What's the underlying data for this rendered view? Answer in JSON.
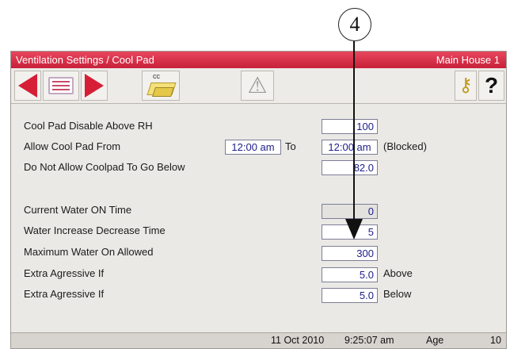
{
  "callout": {
    "number": "4"
  },
  "window": {
    "title": "Ventilation Settings / Cool Pad",
    "house": "Main House 1"
  },
  "toolbar": {
    "prev": "left-arrow-icon",
    "menu": "list-menu-icon",
    "next": "right-arrow-icon",
    "coolpad": "cool-pad-icon",
    "coolpad_text": "cc",
    "alarm": "warning-icon",
    "access": "keys-icon",
    "help": "?"
  },
  "settings": {
    "disable_rh": {
      "label": "Cool Pad Disable Above RH",
      "value": "100"
    },
    "allow_from": {
      "label": "Allow Cool Pad From",
      "from": "12:00 am",
      "to_label": "To",
      "to": "12:00 am",
      "status": "(Blocked)"
    },
    "not_below": {
      "label": "Do Not Allow Coolpad To Go Below",
      "value": "82.0"
    },
    "current_water": {
      "label": "Current Water ON Time",
      "value": "0"
    },
    "water_time": {
      "label": "Water Increase Decrease Time",
      "value": "5"
    },
    "max_water": {
      "label": "Maximum Water On Allowed",
      "value": "300"
    },
    "aggr_above": {
      "label": "Extra Agressive If",
      "value": "5.0",
      "suffix": "Above"
    },
    "aggr_below": {
      "label": "Extra Agressive If",
      "value": "5.0",
      "suffix": "Below"
    }
  },
  "status": {
    "date": "11 Oct 2010",
    "time": "9:25:07 am",
    "age_label": "Age",
    "age": "10"
  },
  "colors": {
    "title_bar": "#d9314a",
    "arrow_red": "#d61f36",
    "field_text": "#20208c",
    "panel": "#ebe9e6"
  }
}
